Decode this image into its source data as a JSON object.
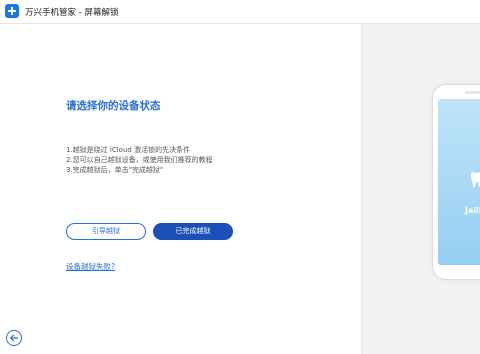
{
  "titlebar": {
    "title": "万兴手机管家 - 屏幕解锁",
    "logo_icon": "plus-icon"
  },
  "main": {
    "heading": "请选择你的设备状态",
    "instructions": [
      "1.越狱是绕过 iCloud 激活锁的先决条件",
      "2.您可以自己越狱设备，或使用我们推荐的教程",
      "3.完成越狱后，单击\"完成越狱\""
    ],
    "guide_button": "引导越狱",
    "done_button": "已完成越狱",
    "fail_link": "设备越狱失败?"
  },
  "phone": {
    "screen_label": "Jailb"
  },
  "colors": {
    "accent": "#2a6fd6",
    "primary_button": "#1c4fb8",
    "logo": "#1976e8",
    "right_panel_bg": "#f2f2f2"
  }
}
